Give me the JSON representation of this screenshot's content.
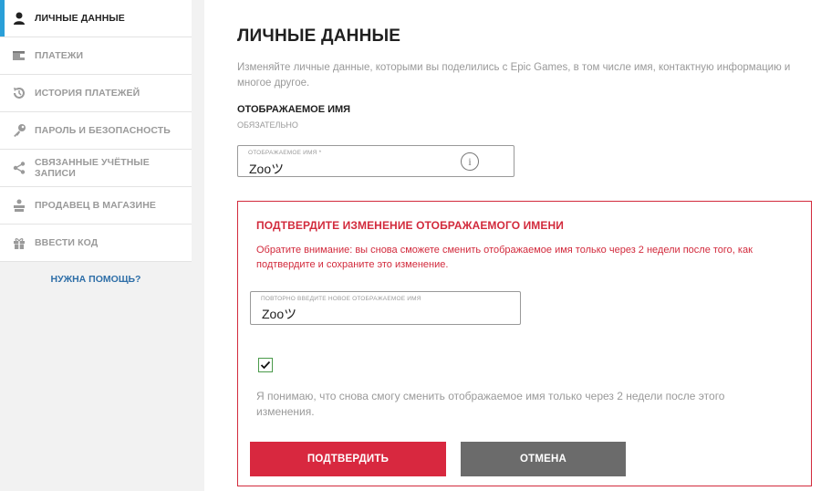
{
  "sidebar": {
    "items": [
      {
        "label": "ЛИЧНЫЕ ДАННЫЕ",
        "icon": "user-icon",
        "active": true
      },
      {
        "label": "ПЛАТЕЖИ",
        "icon": "wallet-icon"
      },
      {
        "label": "ИСТОРИЯ ПЛАТЕЖЕЙ",
        "icon": "history-icon"
      },
      {
        "label": "ПАРОЛЬ И БЕЗОПАСНОСТЬ",
        "icon": "key-icon"
      },
      {
        "label": "СВЯЗАННЫЕ УЧЁТНЫЕ ЗАПИСИ",
        "icon": "share-icon"
      },
      {
        "label": "ПРОДАВЕЦ В МАГАЗИНЕ",
        "icon": "seller-icon"
      },
      {
        "label": "ВВЕСТИ КОД",
        "icon": "gift-icon"
      }
    ],
    "help": "НУЖНА ПОМОЩЬ?"
  },
  "main": {
    "title": "ЛИЧНЫЕ ДАННЫЕ",
    "description": "Изменяйте личные данные, которыми вы поделились с Epic Games, в том числе имя, контактную информацию и многое другое.",
    "display_name": {
      "section_title": "ОТОБРАЖАЕМОЕ ИМЯ",
      "required": "ОБЯЗАТЕЛЬНО",
      "field_label": "ОТОБРАЖАЕМОЕ ИМЯ *",
      "value": "Zooツ"
    },
    "confirm": {
      "title": "ПОДТВЕРДИТЕ ИЗМЕНЕНИЕ ОТОБРАЖАЕМОГО ИМЕНИ",
      "text": "Обратите внимание: вы снова сможете сменить отображаемое имя только через 2 недели после того, как подтвердите и сохраните это изменение.",
      "field_label": "ПОВТОРНО ВВЕДИТЕ НОВОЕ ОТОБРАЖАЕМОЕ ИМЯ",
      "value": "Zooツ",
      "checked": true,
      "checkbox_text": "Я понимаю, что снова смогу сменить отображаемое имя только через 2 недели после этого изменения.",
      "confirm_label": "ПОДТВЕРДИТЬ",
      "cancel_label": "ОТМЕНА"
    }
  },
  "colors": {
    "accent": "#2a9fd8",
    "danger": "#d8283f",
    "cancel": "#6b6b6b"
  }
}
